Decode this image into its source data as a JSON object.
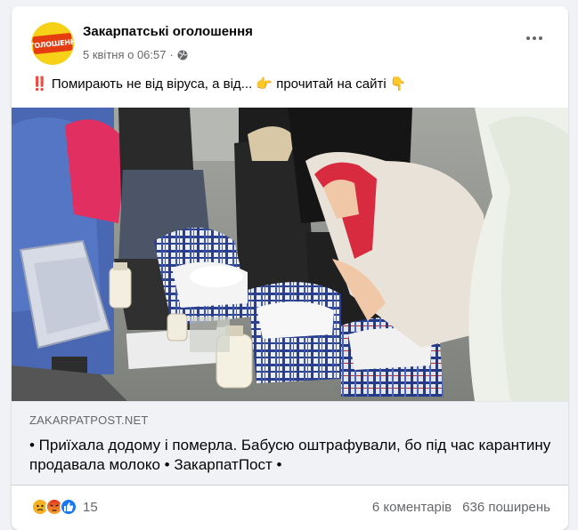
{
  "post": {
    "page_name": "Закарпатські оголошення",
    "avatar_logo_text": "ОГОЛОШЕННЯ",
    "date": "5 квітня о 06:57",
    "separator": "·",
    "privacy_icon": "globe-icon",
    "more_icon": "more-dots-icon",
    "text_lead": "‼️",
    "text_main": " Помирають не від віруса, а від... ",
    "text_point_right": "👉",
    "text_tail": " прочитай на сайті ",
    "text_point_down": "👇"
  },
  "link_preview": {
    "domain": "ZAKARPATPOST.NET",
    "title": "• Приїхала додому і померла. Бабусю оштрафували, бо під час карантину продавала молоко • ЗакарпатПост •"
  },
  "footer": {
    "reaction_icons": [
      "sad-reaction-icon",
      "angry-reaction-icon",
      "like-reaction-icon"
    ],
    "reaction_count": "15",
    "comments": "6 коментарів",
    "shares": "636 поширень"
  },
  "colors": {
    "text_primary": "#050505",
    "text_secondary": "#65676b",
    "card_bg": "#ffffff",
    "page_bg": "#f0f2f5",
    "link_bg": "#f0f2f5",
    "like_blue": "#1877f2",
    "avatar_yellow": "#f7d117",
    "avatar_red": "#e53c12"
  }
}
